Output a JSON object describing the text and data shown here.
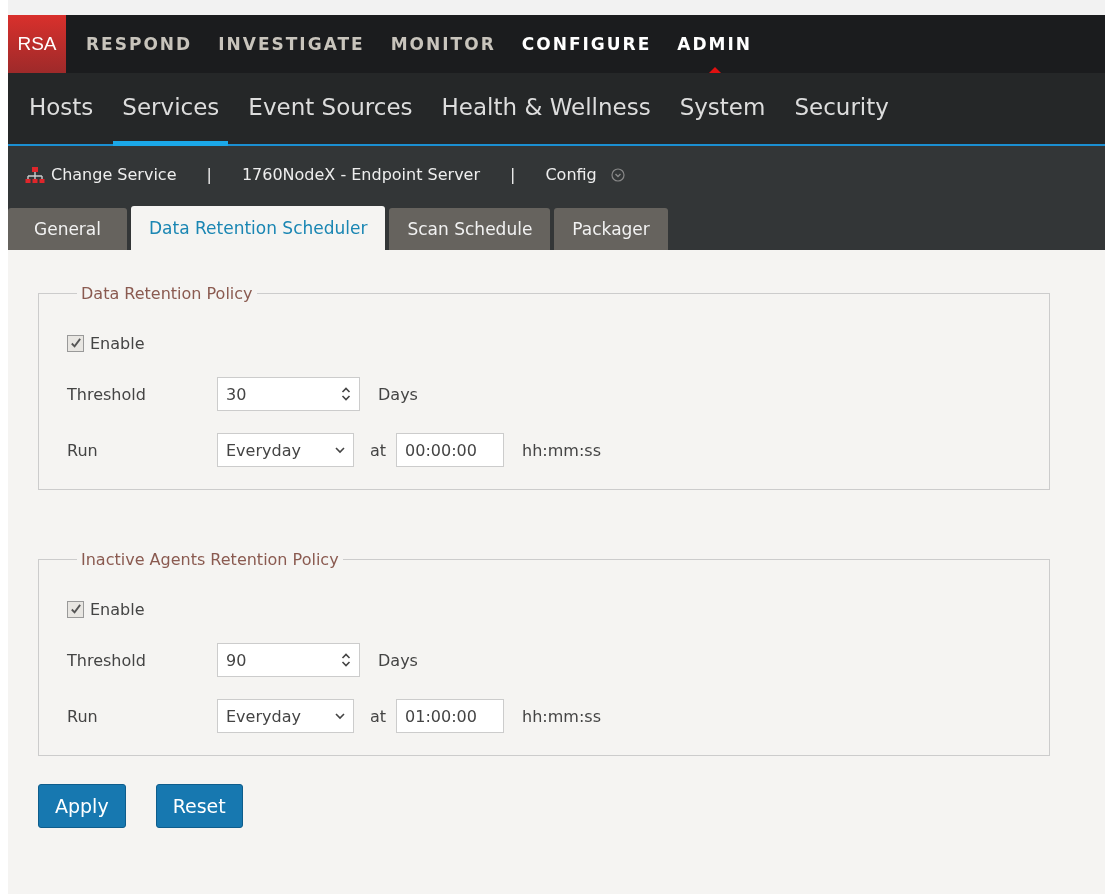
{
  "logo": "RSA",
  "main_nav": [
    {
      "label": "RESPOND",
      "emphasized": false,
      "selected": false
    },
    {
      "label": "INVESTIGATE",
      "emphasized": false,
      "selected": false
    },
    {
      "label": "MONITOR",
      "emphasized": false,
      "selected": false
    },
    {
      "label": "CONFIGURE",
      "emphasized": true,
      "selected": false
    },
    {
      "label": "ADMIN",
      "emphasized": true,
      "selected": true
    }
  ],
  "sub_nav": [
    {
      "label": "Hosts",
      "selected": false
    },
    {
      "label": "Services",
      "selected": true
    },
    {
      "label": "Event Sources",
      "selected": false
    },
    {
      "label": "Health & Wellness",
      "selected": false
    },
    {
      "label": "System",
      "selected": false
    },
    {
      "label": "Security",
      "selected": false
    }
  ],
  "toolbar": {
    "change_service": "Change Service",
    "separator_1": "|",
    "service_name": "1760NodeX - Endpoint Server",
    "separator_2": "|",
    "view": "Config"
  },
  "tabs": [
    {
      "label": "General",
      "selected": false
    },
    {
      "label": "Data Retention Scheduler",
      "selected": true
    },
    {
      "label": "Scan Schedule",
      "selected": false
    },
    {
      "label": "Packager",
      "selected": false
    }
  ],
  "policies": [
    {
      "title": "Data Retention Policy",
      "enable_label": "Enable",
      "enabled": true,
      "threshold_label": "Threshold",
      "threshold": "30",
      "threshold_unit": "Days",
      "run_label": "Run",
      "run": "Everyday",
      "at_label": "at",
      "time": "00:00:00",
      "time_format": "hh:mm:ss"
    },
    {
      "title": "Inactive Agents Retention Policy",
      "enable_label": "Enable",
      "enabled": true,
      "threshold_label": "Threshold",
      "threshold": "90",
      "threshold_unit": "Days",
      "run_label": "Run",
      "run": "Everyday",
      "at_label": "at",
      "time": "01:00:00",
      "time_format": "hh:mm:ss"
    }
  ],
  "buttons": [
    "Apply",
    "Reset"
  ]
}
